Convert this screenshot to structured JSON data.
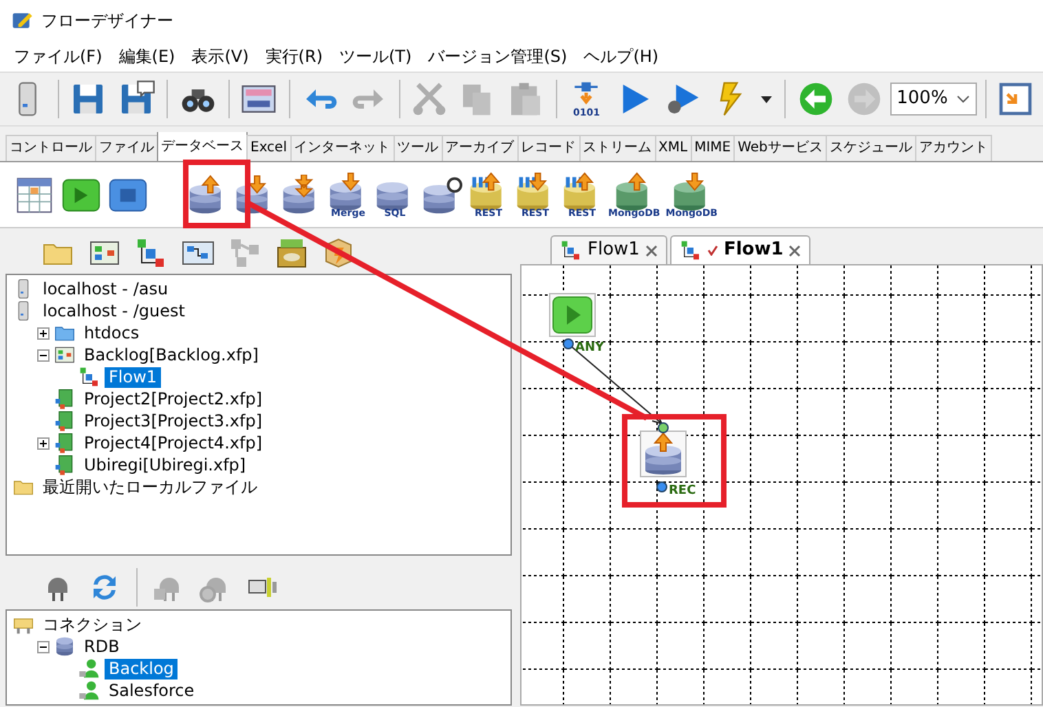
{
  "window": {
    "title": "フローデザイナー"
  },
  "menu": [
    "ファイル(F)",
    "編集(E)",
    "表示(V)",
    "実行(R)",
    "ツール(T)",
    "バージョン管理(S)",
    "ヘルプ(H)"
  ],
  "toolbar": [
    {
      "kind": "server",
      "disabled": false
    },
    {
      "kind": "separator"
    },
    {
      "kind": "save",
      "disabled": false
    },
    {
      "kind": "saveas",
      "disabled": false
    },
    {
      "kind": "separator"
    },
    {
      "kind": "binoculars",
      "disabled": false
    },
    {
      "kind": "separator"
    },
    {
      "kind": "sys",
      "disabled": false
    },
    {
      "kind": "separator"
    },
    {
      "kind": "undo",
      "disabled": false
    },
    {
      "kind": "redo",
      "disabled": true
    },
    {
      "kind": "separator"
    },
    {
      "kind": "cut",
      "disabled": true
    },
    {
      "kind": "copy",
      "disabled": true
    },
    {
      "kind": "paste",
      "disabled": true
    },
    {
      "kind": "separator"
    },
    {
      "kind": "compile",
      "disabled": false,
      "caption": "0101"
    },
    {
      "kind": "run",
      "disabled": false
    },
    {
      "kind": "debug",
      "disabled": false
    },
    {
      "kind": "lightning",
      "disabled": false
    },
    {
      "kind": "dropdown",
      "disabled": false
    },
    {
      "kind": "separator"
    },
    {
      "kind": "back",
      "disabled": false
    },
    {
      "kind": "forward",
      "disabled": true
    },
    {
      "kind": "zoom",
      "value": "100%"
    },
    {
      "kind": "separator"
    },
    {
      "kind": "window",
      "disabled": false
    }
  ],
  "palette_tabs": [
    {
      "label": "コントロール",
      "selected": false
    },
    {
      "label": "ファイル",
      "selected": false
    },
    {
      "label": "データベース",
      "selected": true
    },
    {
      "label": "Excel",
      "selected": false
    },
    {
      "label": "インターネット",
      "selected": false
    },
    {
      "label": "ツール",
      "selected": false
    },
    {
      "label": "アーカイブ",
      "selected": false
    },
    {
      "label": "レコード",
      "selected": false
    },
    {
      "label": "ストリーム",
      "selected": false
    },
    {
      "label": "XML",
      "selected": false
    },
    {
      "label": "MIME",
      "selected": false
    },
    {
      "label": "Webサービス",
      "selected": false
    },
    {
      "label": "スケジュール",
      "selected": false
    },
    {
      "label": "アカウント",
      "selected": false
    }
  ],
  "palette": [
    {
      "kind": "grid"
    },
    {
      "kind": "start"
    },
    {
      "kind": "end"
    },
    {
      "kind": "separator"
    },
    {
      "kind": "db-up"
    },
    {
      "kind": "db-down"
    },
    {
      "kind": "db-down2"
    },
    {
      "kind": "db-down",
      "caption": "Merge"
    },
    {
      "kind": "db",
      "caption": "SQL"
    },
    {
      "kind": "query"
    },
    {
      "kind": "rest-up",
      "caption": "REST"
    },
    {
      "kind": "rest-down",
      "caption": "REST"
    },
    {
      "kind": "rest-up",
      "caption": "REST"
    },
    {
      "kind": "mongo-up",
      "caption": "MongoDB"
    },
    {
      "kind": "mongo-down",
      "caption": "MongoDB"
    }
  ],
  "project_toolbar": [
    {
      "kind": "folder",
      "disabled": false
    },
    {
      "kind": "project",
      "disabled": false
    },
    {
      "kind": "flow",
      "disabled": false
    },
    {
      "kind": "flowbook",
      "disabled": false
    },
    {
      "kind": "nodes",
      "disabled": true
    },
    {
      "kind": "exbox",
      "disabled": false
    },
    {
      "kind": "zip",
      "disabled": false
    }
  ],
  "project_tree": [
    {
      "label": "localhost - /asu",
      "kind": "server",
      "selected": false
    },
    {
      "label": "localhost - /guest",
      "kind": "server",
      "selected": false,
      "children": [
        {
          "label": "htdocs",
          "kind": "bluefolder",
          "selected": false,
          "expanded": false
        },
        {
          "label": "Backlog[Backlog.xfp]",
          "kind": "project",
          "selected": false,
          "expanded": true,
          "children": [
            {
              "label": "Flow1",
              "kind": "flow",
              "selected": true
            }
          ]
        },
        {
          "label": "Project2[Project2.xfp]",
          "kind": "greenproject",
          "selected": false
        },
        {
          "label": "Project3[Project3.xfp]",
          "kind": "greenproject",
          "selected": false
        },
        {
          "label": "Project4[Project4.xfp]",
          "kind": "greenproject",
          "selected": false,
          "expanded": false
        },
        {
          "label": "Ubiregi[Ubiregi.xfp]",
          "kind": "greenproject",
          "selected": false
        }
      ]
    },
    {
      "label": "最近開いたローカルファイル",
      "kind": "folder",
      "selected": false
    }
  ],
  "connection_toolbar": [
    {
      "kind": "plug",
      "disabled": false
    },
    {
      "kind": "refresh",
      "disabled": false
    },
    {
      "kind": "separator"
    },
    {
      "kind": "plugsave",
      "disabled": true
    },
    {
      "kind": "plugstop",
      "disabled": true
    },
    {
      "kind": "connector",
      "disabled": false
    }
  ],
  "connection_tree": [
    {
      "label": "コネクション",
      "kind": "connections",
      "selected": false,
      "children": [
        {
          "label": "RDB",
          "kind": "database",
          "selected": false,
          "expanded": true,
          "children": [
            {
              "label": "Backlog",
              "kind": "user",
              "selected": true
            },
            {
              "label": "Salesforce",
              "kind": "user",
              "selected": false
            }
          ]
        }
      ]
    }
  ],
  "flow_tabs": [
    {
      "label": "Flow1",
      "selected": false,
      "modified": false
    },
    {
      "label": "Flow1",
      "selected": true,
      "modified": true
    }
  ],
  "canvas": {
    "nodes": [
      {
        "kind": "start",
        "port_label": "ANY"
      },
      {
        "kind": "db-up",
        "port_label": "REC"
      }
    ]
  }
}
